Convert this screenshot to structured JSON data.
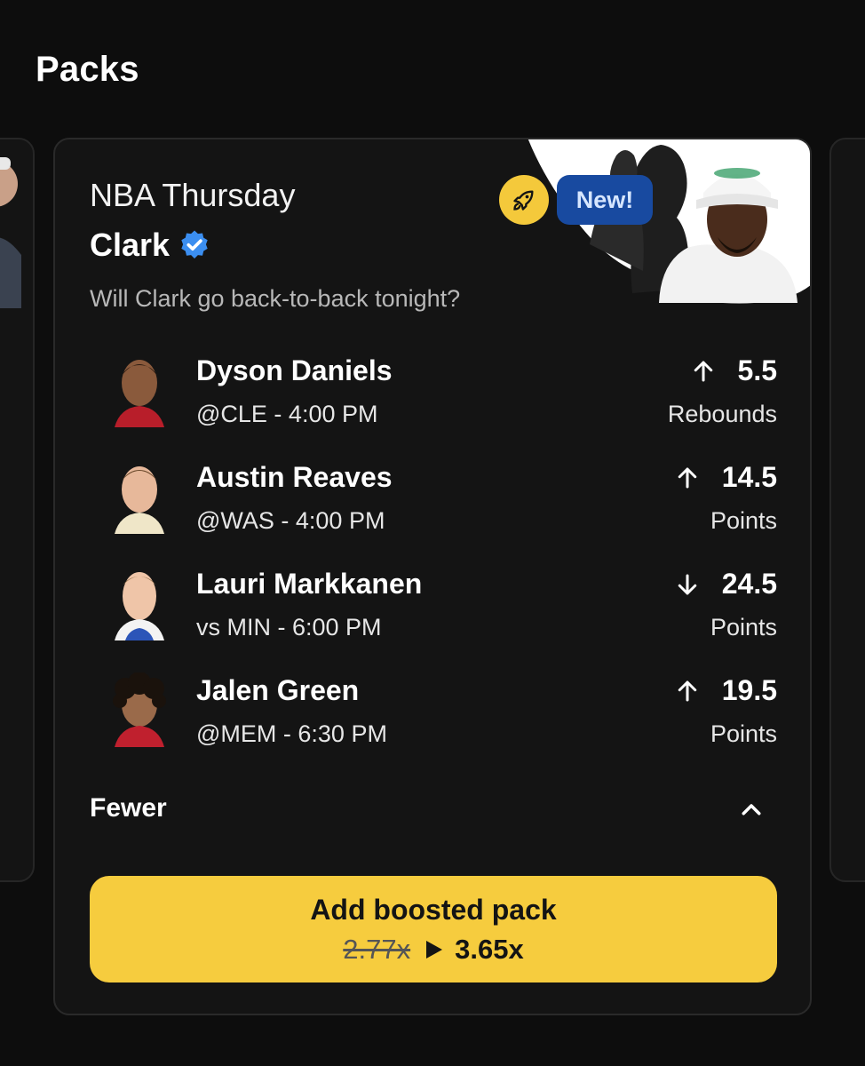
{
  "page": {
    "title": "Packs"
  },
  "card": {
    "league_day": "NBA Thursday",
    "creator": "Clark",
    "badge_new": "New!",
    "description": "Will Clark go back-to-back tonight?",
    "players": [
      {
        "name": "Dyson Daniels",
        "game": "@CLE - 4:00 PM",
        "direction": "up",
        "line": "5.5",
        "stat": "Rebounds"
      },
      {
        "name": "Austin Reaves",
        "game": "@WAS - 4:00 PM",
        "direction": "up",
        "line": "14.5",
        "stat": "Points"
      },
      {
        "name": "Lauri Markkanen",
        "game": "vs MIN - 6:00 PM",
        "direction": "down",
        "line": "24.5",
        "stat": "Points"
      },
      {
        "name": "Jalen Green",
        "game": "@MEM - 6:30 PM",
        "direction": "up",
        "line": "19.5",
        "stat": "Points"
      }
    ],
    "toggle_label": "Fewer",
    "cta": {
      "label": "Add boosted pack",
      "old_odds": "2.77x",
      "new_odds": "3.65x"
    }
  },
  "colors": {
    "accent_yellow": "#f6cc3e",
    "badge_blue": "#184aa0",
    "background": "#0d0d0d",
    "card": "#141414"
  },
  "icons": [
    "rocket-icon",
    "verified-icon",
    "arrow-up-icon",
    "arrow-down-icon",
    "chevron-up-icon",
    "play-icon"
  ]
}
